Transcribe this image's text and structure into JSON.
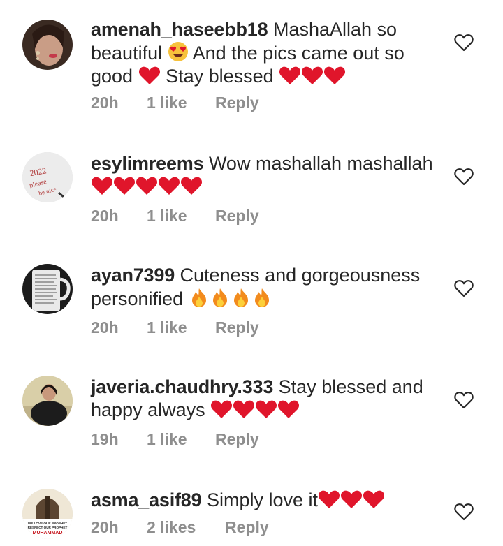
{
  "comments": [
    {
      "username": "amenah_haseebb18",
      "text_parts": [
        "MashaAllah so beautiful ",
        " And the pics came out so good ",
        " Stay blessed "
      ],
      "time": "20h",
      "likes": "1 like",
      "reply_label": "Reply",
      "avatar_icon": "profile-photo-woman"
    },
    {
      "username": "esylimreems",
      "text_parts": [
        "Wow mashallah mashallah"
      ],
      "time": "20h",
      "likes": "1 like",
      "reply_label": "Reply",
      "avatar_icon": "profile-photo-note",
      "avatar_text": [
        "2022",
        "please",
        "be nice"
      ]
    },
    {
      "username": "ayan7399",
      "text_parts": [
        "Cuteness and gorgeousness personified "
      ],
      "time": "20h",
      "likes": "1 like",
      "reply_label": "Reply",
      "avatar_icon": "profile-photo-mug"
    },
    {
      "username": "javeria.chaudhry.333",
      "text_parts": [
        "Stay blessed and happy always "
      ],
      "time": "19h",
      "likes": "1 like",
      "reply_label": "Reply",
      "avatar_icon": "profile-photo-woman-seated"
    },
    {
      "username": "asma_asif89",
      "text_parts": [
        "Simply love it"
      ],
      "time": "20h",
      "likes": "2 likes",
      "reply_label": "Reply",
      "avatar_icon": "profile-photo-mosque",
      "avatar_text": [
        "WE LOVE OUR PROPHET",
        "RESPECT OUR PROPHET",
        "MUHAMMAD"
      ]
    }
  ],
  "colors": {
    "heart_red": "#e0152b",
    "meta_gray": "#8e8e8e",
    "text": "#262626"
  }
}
